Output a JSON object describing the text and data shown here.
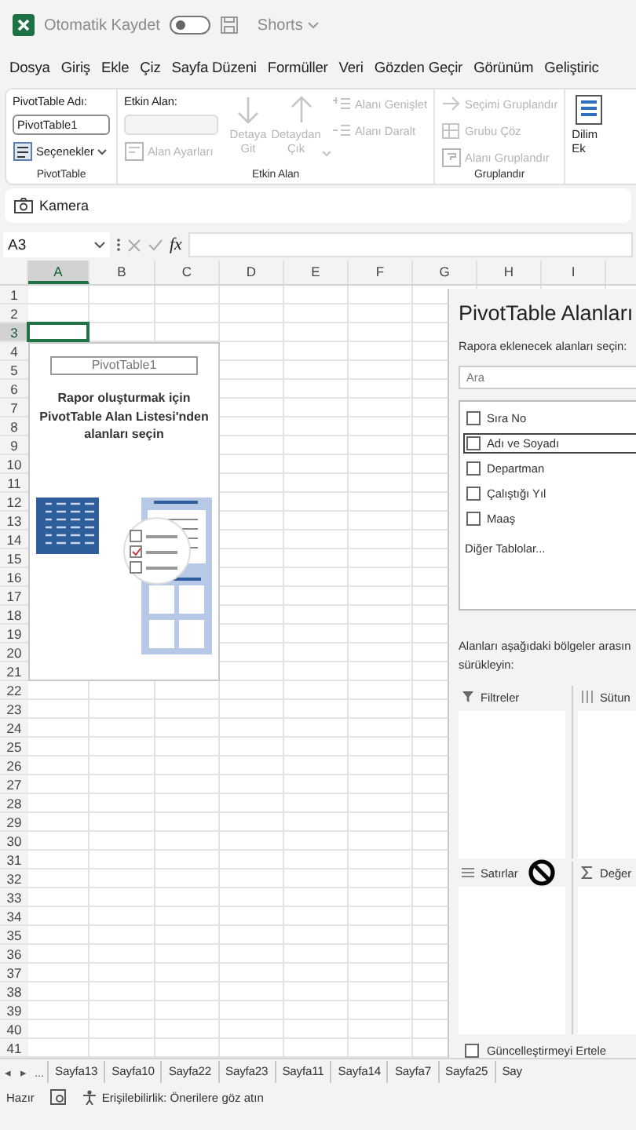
{
  "title_bar": {
    "autosave_label": "Otomatik Kaydet",
    "autosave_on": false,
    "file_name": "Shorts"
  },
  "menu_tabs": [
    {
      "label": "Dosya",
      "selected": false
    },
    {
      "label": "Giriş",
      "selected": false
    },
    {
      "label": "Ekle",
      "selected": false
    },
    {
      "label": "Çiz",
      "selected": false
    },
    {
      "label": "Sayfa Düzeni",
      "selected": false
    },
    {
      "label": "Formüller",
      "selected": false
    },
    {
      "label": "Veri",
      "selected": false
    },
    {
      "label": "Gözden Geçir",
      "selected": false
    },
    {
      "label": "Görünüm",
      "selected": false
    },
    {
      "label": "Geliştiric",
      "selected": false
    }
  ],
  "ribbon": {
    "groups": [
      {
        "label": "PivotTable",
        "columns": [
          [
            {
              "kind": "label",
              "text": "PivotTable Adı:",
              "disabled": false
            },
            {
              "kind": "field",
              "value": "PivotTable1",
              "disabled": false
            },
            {
              "kind": "dropdown",
              "text": "Seçenekler",
              "disabled": false
            }
          ]
        ]
      },
      {
        "label": "Etkin Alan",
        "columns": [
          [
            {
              "kind": "label",
              "text": "Etkin Alan:",
              "disabled": false
            },
            {
              "kind": "field",
              "disabled": true
            },
            {
              "kind": "small",
              "text": "Alan Ayarları",
              "disabled": true
            }
          ],
          [
            {
              "kind": "large",
              "text": "Detaya Git",
              "disabled": true
            }
          ],
          [
            {
              "kind": "large-dropdown",
              "text": "Detaydan Çık",
              "disabled": true
            }
          ],
          [
            {
              "kind": "small",
              "text": "Alanı Genişlet",
              "disabled": true
            },
            {
              "kind": "small",
              "text": "Alanı Daralt",
              "disabled": true
            }
          ]
        ]
      },
      {
        "label": "Gruplandır",
        "columns": [
          [
            {
              "kind": "small",
              "text": "Seçimi Gruplandır",
              "disabled": true
            },
            {
              "kind": "small",
              "text": "Grubu Çöz",
              "disabled": true
            },
            {
              "kind": "small",
              "text": "Alanı Gruplandır",
              "disabled": true
            }
          ]
        ]
      },
      {
        "columns": [
          [
            {
              "kind": "large",
              "text": "Dilim Ek",
              "disabled": false
            }
          ]
        ]
      }
    ]
  },
  "quick_access": {
    "label": "Kamera"
  },
  "formula_bar": {
    "name_box": "A3",
    "function_label": "fx"
  },
  "grid": {
    "columns": [
      {
        "label": "A",
        "selected": true
      },
      {
        "label": "B",
        "selected": false
      },
      {
        "label": "C",
        "selected": false
      },
      {
        "label": "D",
        "selected": false
      },
      {
        "label": "E",
        "selected": false
      },
      {
        "label": "F",
        "selected": false
      },
      {
        "label": "G",
        "selected": false
      },
      {
        "label": "H",
        "selected": false
      },
      {
        "label": "I",
        "selected": false
      }
    ],
    "rows": [
      {
        "label": "1",
        "selected": false
      },
      {
        "label": "2",
        "selected": false
      },
      {
        "label": "3",
        "selected": true
      },
      {
        "label": "4",
        "selected": false
      },
      {
        "label": "5",
        "selected": false
      },
      {
        "label": "6",
        "selected": false
      },
      {
        "label": "7",
        "selected": false
      },
      {
        "label": "8",
        "selected": false
      },
      {
        "label": "9",
        "selected": false
      },
      {
        "label": "10",
        "selected": false
      },
      {
        "label": "11",
        "selected": false
      },
      {
        "label": "12",
        "selected": false
      },
      {
        "label": "13",
        "selected": false
      },
      {
        "label": "14",
        "selected": false
      },
      {
        "label": "15",
        "selected": false
      },
      {
        "label": "16",
        "selected": false
      },
      {
        "label": "17",
        "selected": false
      },
      {
        "label": "18",
        "selected": false
      },
      {
        "label": "19",
        "selected": false
      },
      {
        "label": "20",
        "selected": false
      },
      {
        "label": "21",
        "selected": false
      },
      {
        "label": "22",
        "selected": false
      },
      {
        "label": "23",
        "selected": false
      },
      {
        "label": "24",
        "selected": false
      },
      {
        "label": "25",
        "selected": false
      },
      {
        "label": "26",
        "selected": false
      },
      {
        "label": "27",
        "selected": false
      },
      {
        "label": "28",
        "selected": false
      },
      {
        "label": "29",
        "selected": false
      },
      {
        "label": "30",
        "selected": false
      },
      {
        "label": "31",
        "selected": false
      },
      {
        "label": "32",
        "selected": false
      },
      {
        "label": "33",
        "selected": false
      },
      {
        "label": "34",
        "selected": false
      },
      {
        "label": "35",
        "selected": false
      },
      {
        "label": "36",
        "selected": false
      },
      {
        "label": "37",
        "selected": false
      },
      {
        "label": "38",
        "selected": false
      },
      {
        "label": "39",
        "selected": false
      },
      {
        "label": "40",
        "selected": false
      },
      {
        "label": "41",
        "selected": false
      }
    ]
  },
  "pivot_placeholder": {
    "name": "PivotTable1",
    "message": "Rapor oluşturmak için PivotTable Alan Listesi'nden alanları seçin"
  },
  "pivot_pane": {
    "title": "PivotTable Alanları",
    "subtitle": "Rapora eklenecek alanları seçin:",
    "search": {
      "placeholder": "Ara"
    },
    "fields": [
      {
        "label": "Sıra No",
        "checked": false,
        "hovered": false
      },
      {
        "label": "Adı ve Soyadı",
        "checked": false,
        "hovered": true
      },
      {
        "label": "Departman",
        "checked": false,
        "hovered": false
      },
      {
        "label": "Çalıştığı Yıl",
        "checked": false,
        "hovered": false
      },
      {
        "label": "Maaş",
        "checked": false,
        "hovered": false
      }
    ],
    "more_tables": "Diğer Tablolar...",
    "hint_lines": [
      "Alanları aşağıdaki bölgeler arasın",
      "sürükleyin:"
    ],
    "areas": [
      {
        "label": "Filtreler"
      },
      {
        "label": "Sütun"
      },
      {
        "label": "Satırlar"
      },
      {
        "label": "Değer"
      }
    ],
    "defer_update": {
      "label": "Güncelleştirmeyi Ertele",
      "checked": false
    }
  },
  "sheet_tabs": {
    "nav": [
      "◂",
      "▸",
      "..."
    ],
    "tabs": [
      {
        "label": "Sayfa13",
        "selected": false
      },
      {
        "label": "Sayfa10",
        "selected": false
      },
      {
        "label": "Sayfa22",
        "selected": false
      },
      {
        "label": "Sayfa23",
        "selected": false
      },
      {
        "label": "Sayfa11",
        "selected": false
      },
      {
        "label": "Sayfa14",
        "selected": false
      },
      {
        "label": "Sayfa7",
        "selected": false
      },
      {
        "label": "Sayfa25",
        "selected": false
      },
      {
        "label": "Say",
        "selected": false
      }
    ]
  },
  "status_bar": {
    "state": "Hazır",
    "accessibility": "Erişilebilirlik: Önerilere göz atın"
  }
}
